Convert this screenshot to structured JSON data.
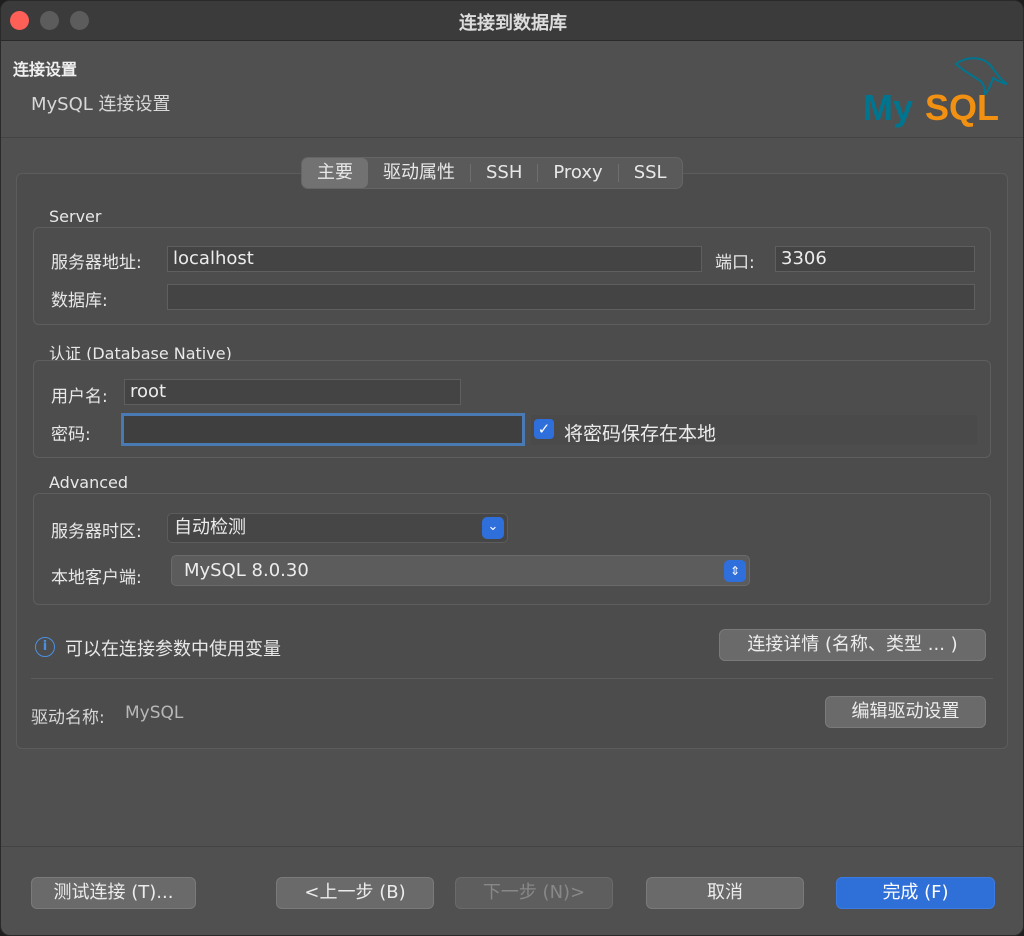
{
  "window": {
    "title": "连接到数据库"
  },
  "header": {
    "title": "连接设置",
    "subtitle": "MySQL 连接设置",
    "logo_text": "MySQL"
  },
  "tabs": [
    {
      "label": "主要",
      "active": true
    },
    {
      "label": "驱动属性",
      "active": false
    },
    {
      "label": "SSH",
      "active": false
    },
    {
      "label": "Proxy",
      "active": false
    },
    {
      "label": "SSL",
      "active": false
    }
  ],
  "server": {
    "section_label": "Server",
    "host_label": "服务器地址:",
    "host_value": "localhost",
    "port_label": "端口:",
    "port_value": "3306",
    "database_label": "数据库:",
    "database_value": ""
  },
  "auth": {
    "section_label": "认证 (Database Native)",
    "username_label": "用户名:",
    "username_value": "root",
    "password_label": "密码:",
    "password_value": "",
    "save_password_label": "将密码保存在本地",
    "save_password_checked": true
  },
  "advanced": {
    "section_label": "Advanced",
    "timezone_label": "服务器时区:",
    "timezone_value": "自动检测",
    "client_label": "本地客户端:",
    "client_value": "MySQL 8.0.30"
  },
  "info": {
    "text": "可以在连接参数中使用变量",
    "details_button": "连接详情 (名称、类型 ... )"
  },
  "driver": {
    "label": "驱动名称:",
    "value": "MySQL",
    "edit_button": "编辑驱动设置"
  },
  "footer": {
    "test_button": "测试连接 (T)...",
    "back_button": "<上一步 (B)",
    "next_button": "下一步 (N)>",
    "cancel_button": "取消",
    "finish_button": "完成 (F)"
  },
  "colors": {
    "accent": "#2e6fd8",
    "close": "#fe5f57",
    "logo_blue": "#00758f",
    "logo_orange": "#f29111"
  }
}
